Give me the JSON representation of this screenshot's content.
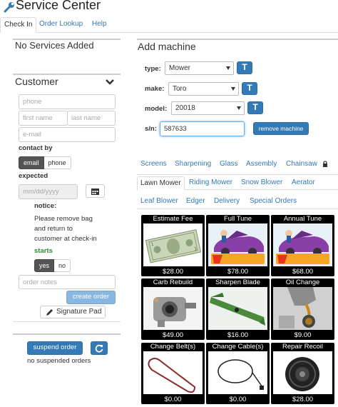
{
  "header": {
    "title": "Service Center"
  },
  "nav": {
    "tabs": [
      "Check In",
      "Order Lookup",
      "Help"
    ]
  },
  "services": {
    "title": "No Services Added"
  },
  "customer": {
    "title": "Customer",
    "phone_placeholder": "phone",
    "first_name_placeholder": "first name",
    "last_name_placeholder": "last name",
    "email_placeholder": "e-mail",
    "contact_by_label": "contact by",
    "contact_options": [
      "email",
      "phone"
    ],
    "expected_label": "expected",
    "date_placeholder": "mm/dd/yyyy",
    "notice_label": "notice:",
    "notice_lines": [
      "Please remove bag",
      "and return to",
      "customer at check-in"
    ],
    "starts_label": "starts",
    "starts_options": [
      "yes",
      "no"
    ],
    "order_notes_placeholder": "order notes",
    "create_order_label": "create order",
    "signature_pad_label": "Signature Pad"
  },
  "orders": {
    "suspend_label": "suspend order",
    "none_text": "no suspended orders"
  },
  "machine": {
    "title": "Add machine",
    "type_label": "type:",
    "type_value": "Mower",
    "make_label": "make:",
    "make_value": "Toro",
    "model_label": "model:",
    "model_value": "20018",
    "sn_label": "s/n:",
    "sn_value": "587633",
    "remove_label": "remove machine"
  },
  "categories": [
    "Screens",
    "Sharpening",
    "Glass",
    "Assembly",
    "Chainsaw"
  ],
  "subcategories": [
    "Lawn Mower",
    "Riding Mower",
    "Snow Blower",
    "Aerator",
    "Leaf Blower",
    "Edger",
    "Delivery",
    "Special Orders"
  ],
  "services_grid": [
    {
      "name": "Estimate Fee",
      "price": "$28.00",
      "icon": "dollar-bill"
    },
    {
      "name": "Full Tune",
      "price": "$78.00",
      "icon": "tune-up-car"
    },
    {
      "name": "Annual Tune",
      "price": "$68.00",
      "icon": "tune-up-car"
    },
    {
      "name": "Carb Rebuild",
      "price": "$49.00",
      "icon": "carburetor"
    },
    {
      "name": "Sharpen Blade",
      "price": "$16.00",
      "icon": "mower-blade"
    },
    {
      "name": "Oil Change",
      "price": "$9.00",
      "icon": "oil-pour"
    },
    {
      "name": "Change Belt(s)",
      "price": "$0.00",
      "icon": "drive-belt"
    },
    {
      "name": "Change Cable(s)",
      "price": "$0.00",
      "icon": "control-cable"
    },
    {
      "name": "Repair Recoil",
      "price": "$28.00",
      "icon": "recoil-starter"
    }
  ]
}
